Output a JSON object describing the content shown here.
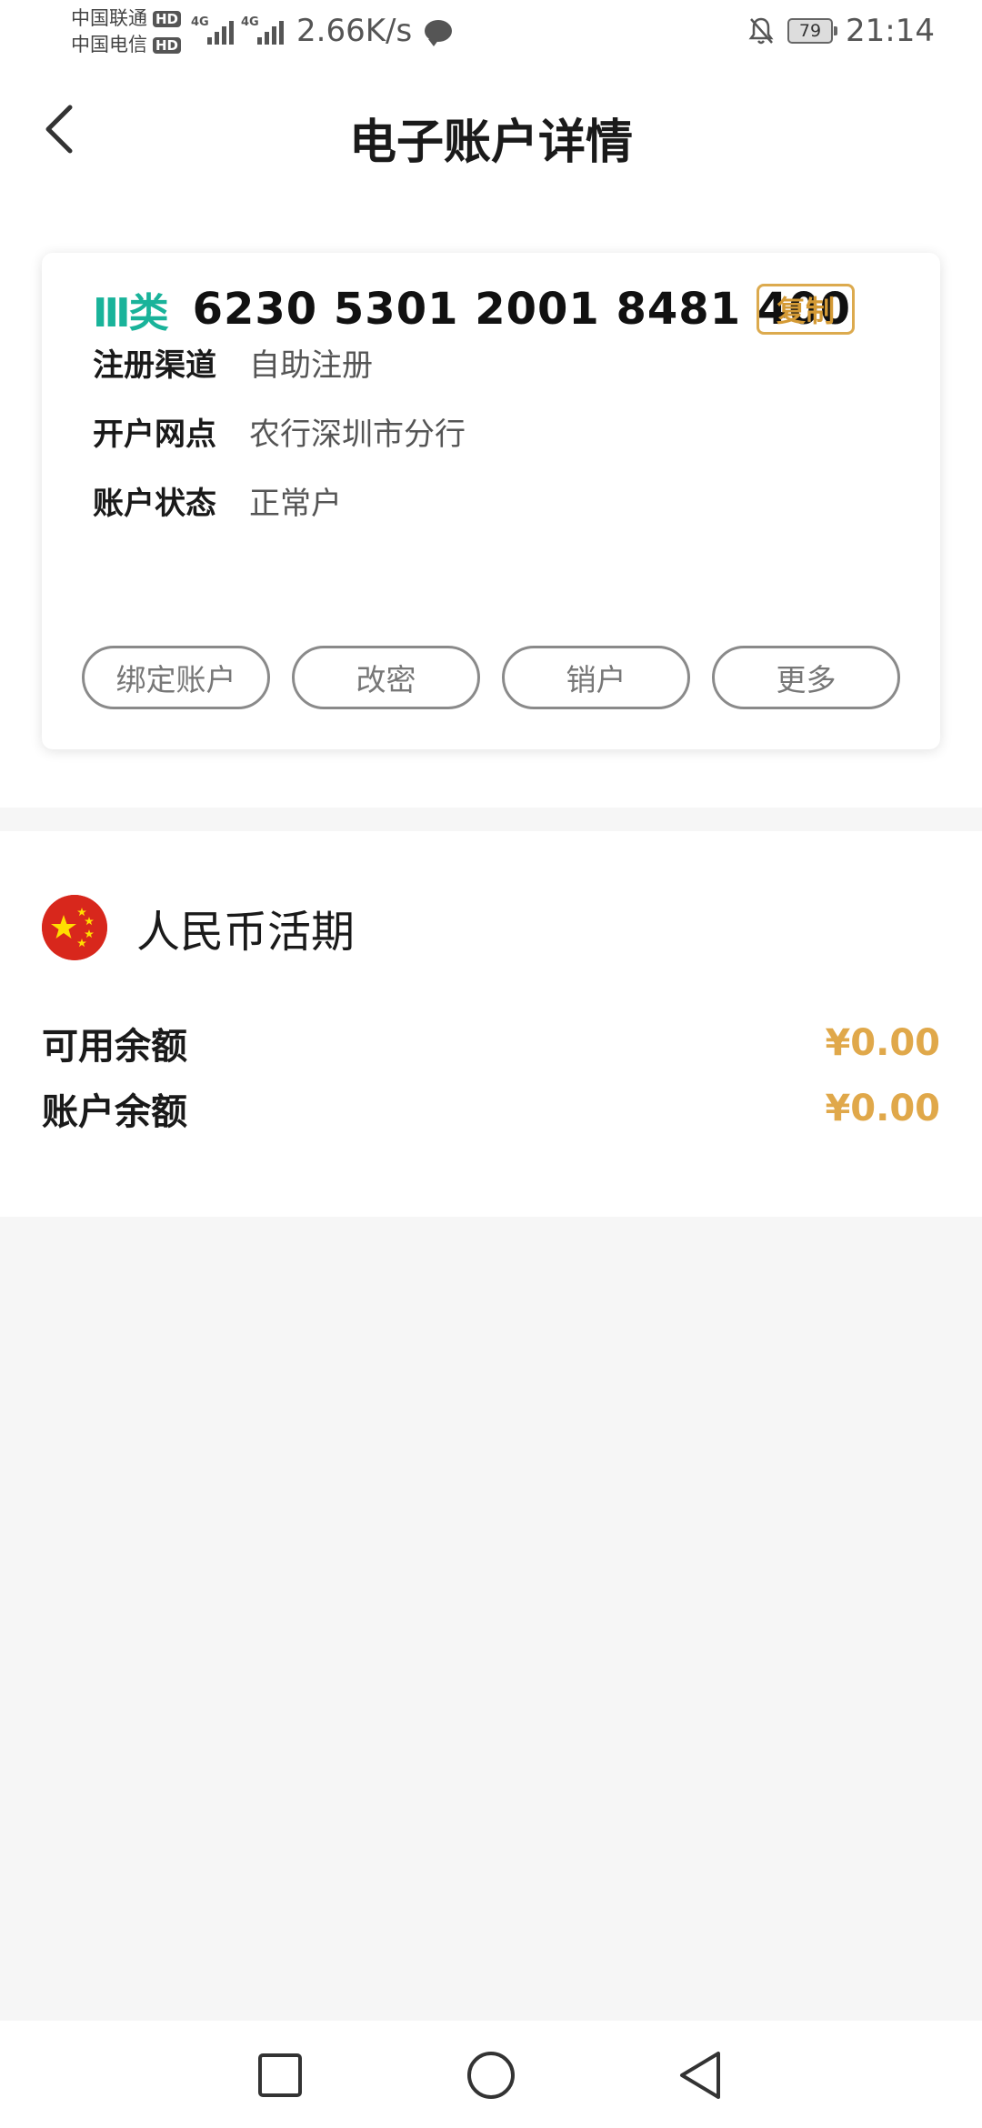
{
  "status_bar": {
    "carrier1": "中国联通",
    "carrier2": "中国电信",
    "hd_label": "HD",
    "network1": "4G",
    "network2": "4G",
    "speed": "2.66K/s",
    "battery": "79",
    "time": "21:14",
    "icons": [
      "chat-icon",
      "bell-off-icon",
      "battery-icon"
    ]
  },
  "header": {
    "title": "电子账户详情",
    "back_icon": "chevron-left-icon"
  },
  "account_card": {
    "account_class": "Ⅲ类",
    "account_number": "6230 5301 2001 8481 400",
    "copy_label": "复制",
    "info": [
      {
        "label": "注册渠道",
        "value": "自助注册"
      },
      {
        "label": "开户网点",
        "value": "农行深圳市分行"
      },
      {
        "label": "账户状态",
        "value": "正常户"
      }
    ],
    "actions": [
      "绑定账户",
      "改密",
      "销户",
      "更多"
    ],
    "accent_color": "#19b39a",
    "copy_color": "#d49a35"
  },
  "balance": {
    "currency_title": "人民币活期",
    "flag_icon": "china-flag-icon",
    "rows": [
      {
        "label": "可用余额",
        "value": "¥0.00"
      },
      {
        "label": "账户余额",
        "value": "¥0.00"
      }
    ],
    "amount_color": "#e0a84a"
  },
  "nav_bar": {
    "icons": [
      "recent-apps-icon",
      "home-icon",
      "back-icon"
    ]
  }
}
